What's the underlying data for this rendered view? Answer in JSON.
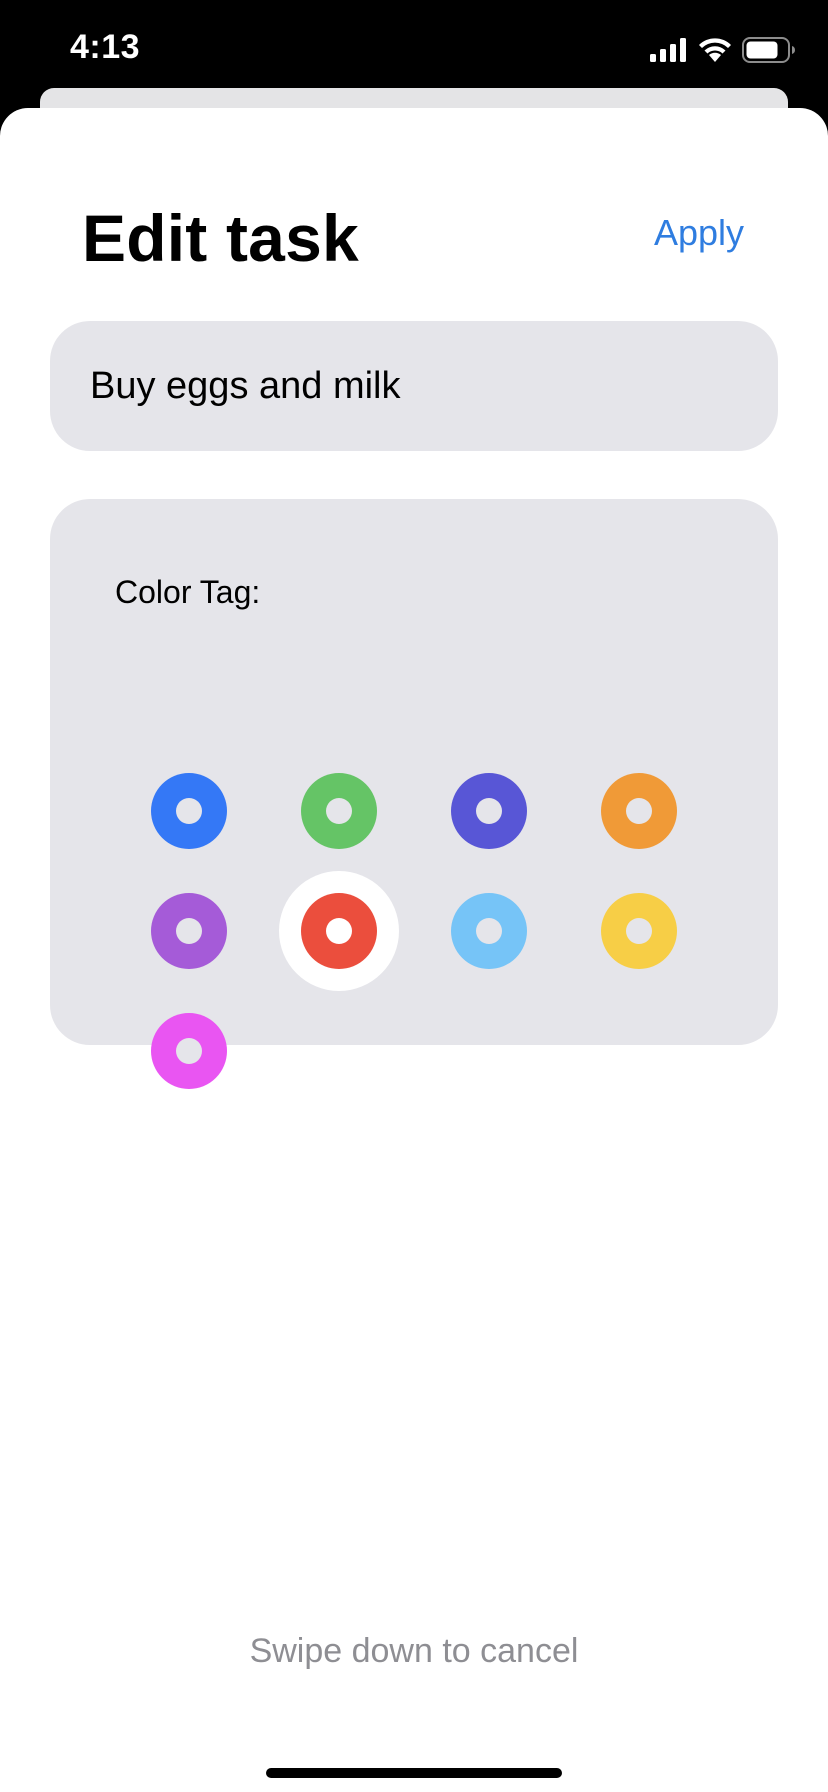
{
  "status_bar": {
    "time": "4:13",
    "signal_icon": "cellular-signal-icon",
    "wifi_icon": "wifi-icon",
    "battery_icon": "battery-icon"
  },
  "sheet": {
    "title": "Edit task",
    "apply_label": "Apply",
    "task_value": "Buy eggs and milk",
    "color_tag_label": "Color Tag:",
    "cancel_hint": "Swipe down to cancel"
  },
  "color_tags": [
    {
      "name": "blue",
      "color": "#3478f6",
      "selected": false
    },
    {
      "name": "green",
      "color": "#65c466",
      "selected": false
    },
    {
      "name": "indigo",
      "color": "#5856d6",
      "selected": false
    },
    {
      "name": "orange",
      "color": "#f09a37",
      "selected": false
    },
    {
      "name": "purple",
      "color": "#a55bd8",
      "selected": false
    },
    {
      "name": "red",
      "color": "#eb4e3d",
      "selected": true
    },
    {
      "name": "light-blue",
      "color": "#76c4f7",
      "selected": false
    },
    {
      "name": "yellow",
      "color": "#f7ce46",
      "selected": false
    },
    {
      "name": "pink",
      "color": "#e955f2",
      "selected": false
    }
  ],
  "colors": {
    "accent": "#2f7de0",
    "card_bg": "#e5e5ea",
    "hint": "#8e8e93"
  }
}
